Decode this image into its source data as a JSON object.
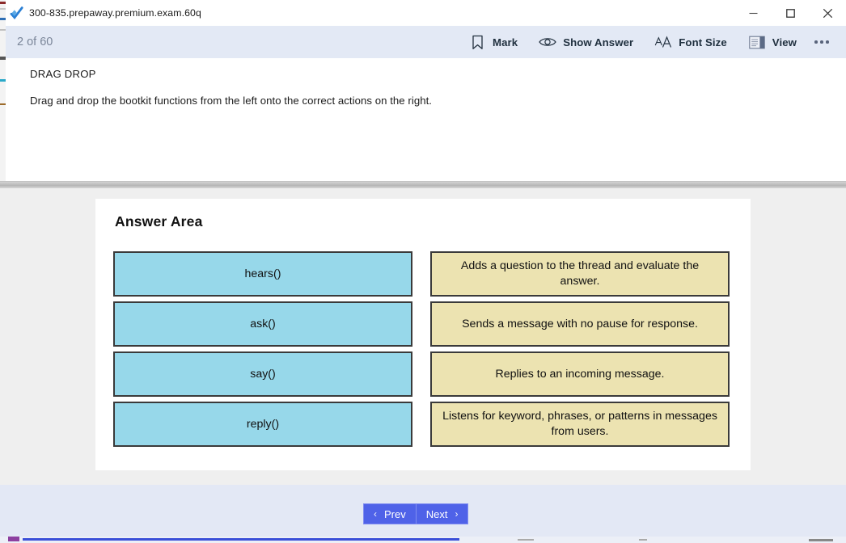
{
  "window": {
    "title": "300-835.prepaway.premium.exam.60q",
    "app_icon": "checkmark-icon",
    "controls": {
      "minimize": "minimize-icon",
      "maximize": "maximize-icon",
      "close": "close-icon"
    }
  },
  "toolbar": {
    "counter": "2 of 60",
    "items": [
      {
        "label": "Mark",
        "icon": "bookmark-icon"
      },
      {
        "label": "Show Answer",
        "icon": "eye-icon"
      },
      {
        "label": "Font Size",
        "icon": "font-size-icon"
      },
      {
        "label": "View",
        "icon": "view-layout-icon"
      }
    ],
    "more": "more-icon"
  },
  "question": {
    "type": "DRAG DROP",
    "prompt": "Drag and drop the bootkit functions from the left onto the correct actions on the right."
  },
  "answer_area": {
    "title": "Answer Area",
    "left_items": [
      "hears()",
      "ask()",
      "say()",
      "reply()"
    ],
    "right_items": [
      "Adds a question to the thread and evaluate the answer.",
      "Sends a message with no pause for response.",
      "Replies to an incoming message.",
      "Listens for keyword, phrases, or patterns in messages from users."
    ]
  },
  "navigation": {
    "prev_label": "Prev",
    "next_label": "Next",
    "prev_chevron": "‹",
    "next_chevron": "›"
  },
  "colors": {
    "left_box": "#97d8ea",
    "right_box": "#ece3b1",
    "box_border": "#3a3a3a",
    "toolbar_bg": "#e3e9f5",
    "nav_button": "#4f62e8",
    "counter_text": "#7b8699"
  }
}
